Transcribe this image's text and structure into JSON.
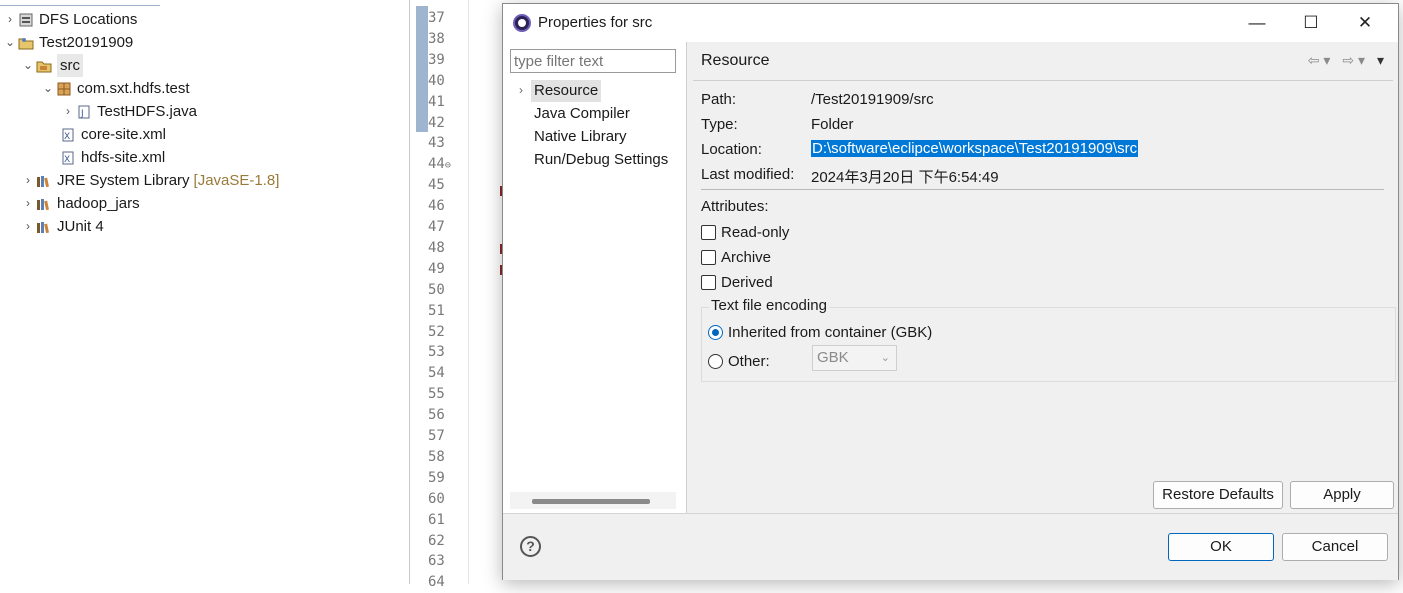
{
  "explorer": {
    "items": [
      {
        "label": "DFS Locations",
        "chevron": "›",
        "icon": "dfs-locations-icon",
        "decoration": ""
      },
      {
        "label": "Test20191909",
        "chevron": "⌄",
        "icon": "java-project-icon",
        "decoration": ""
      },
      {
        "label": "src",
        "chevron": "⌄",
        "icon": "source-folder-icon",
        "decoration": ""
      },
      {
        "label": "com.sxt.hdfs.test",
        "chevron": "⌄",
        "icon": "package-icon",
        "decoration": ""
      },
      {
        "label": "TestHDFS.java",
        "chevron": "›",
        "icon": "java-file-icon",
        "decoration": ""
      },
      {
        "label": "core-site.xml",
        "chevron": "",
        "icon": "xml-file-icon",
        "decoration": ""
      },
      {
        "label": "hdfs-site.xml",
        "chevron": "",
        "icon": "xml-file-icon",
        "decoration": ""
      },
      {
        "label": "JRE System Library",
        "chevron": "›",
        "icon": "library-icon",
        "decoration": "[JavaSE-1.8]"
      },
      {
        "label": "hadoop_jars",
        "chevron": "›",
        "icon": "library-icon",
        "decoration": ""
      },
      {
        "label": "JUnit 4",
        "chevron": "›",
        "icon": "library-icon",
        "decoration": ""
      }
    ]
  },
  "editor": {
    "line_numbers": [
      "37",
      "38",
      "39",
      "40",
      "41",
      "42",
      "43",
      "44",
      "45",
      "46",
      "47",
      "48",
      "49",
      "50",
      "51",
      "52",
      "53",
      "54",
      "55",
      "56",
      "57",
      "58",
      "59",
      "60",
      "61",
      "62",
      "63",
      "64"
    ],
    "fold_marker": "⊖"
  },
  "dialog": {
    "title": "Properties for src",
    "window_controls": {
      "minimize": "—",
      "maximize": "☐",
      "close": "✕"
    },
    "filter_placeholder": "type filter text",
    "nav_items": [
      "Resource",
      "Java Compiler",
      "Native Library",
      "Run/Debug Settings"
    ],
    "page_title": "Resource",
    "properties": {
      "path_label": "Path:",
      "path_value": "/Test20191909/src",
      "type_label": "Type:",
      "type_value": "Folder",
      "location_label": "Location:",
      "location_value": "D:\\software\\eclipce\\workspace\\Test20191909\\src",
      "modified_label": "Last modified:",
      "modified_value": "2024年3月20日 下午6:54:49"
    },
    "attributes_label": "Attributes:",
    "checkboxes": [
      {
        "label": "Read-only",
        "checked": false
      },
      {
        "label": "Archive",
        "checked": false
      },
      {
        "label": "Derived",
        "checked": false
      }
    ],
    "encoding": {
      "legend": "Text file encoding",
      "inherited_label": "Inherited from container (GBK)",
      "other_label": "Other:",
      "other_value": "GBK",
      "selected": "inherited"
    },
    "buttons": {
      "restore_defaults": "Restore Defaults",
      "apply": "Apply",
      "ok": "OK",
      "cancel": "Cancel"
    },
    "help": "?"
  },
  "colors": {
    "selection_blue": "#0078d7",
    "ruler_blue": "#9fb4cf",
    "decoration_brown": "#9a7a3a"
  }
}
